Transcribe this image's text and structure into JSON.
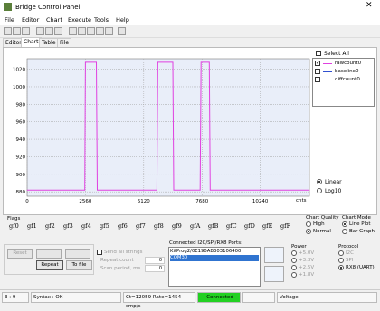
{
  "app": {
    "title": "Bridge Control Panel"
  },
  "menu": [
    "File",
    "Editor",
    "Chart",
    "Execute",
    "Tools",
    "Help"
  ],
  "tabs": [
    "Editor",
    "Chart",
    "Table",
    "File"
  ],
  "legend": {
    "select_all": "Select All",
    "items": [
      {
        "label": "rawcount0",
        "color": "#e040e0",
        "checked": true
      },
      {
        "label": "baseline0",
        "color": "#3050d0",
        "checked": false
      },
      {
        "label": "diffcount0",
        "color": "#40c0e0",
        "checked": false
      }
    ]
  },
  "scale": {
    "options": [
      "Linear",
      "Log10"
    ],
    "selected": "Linear"
  },
  "x_unit": "cnts",
  "flags": {
    "label": "Flags",
    "items": [
      "gf0",
      "gf1",
      "gf2",
      "gf3",
      "gf4",
      "gf5",
      "gf6",
      "gf7",
      "gf8",
      "gf9",
      "gfA",
      "gfB",
      "gfC",
      "gfD",
      "gfE",
      "gfF"
    ]
  },
  "chart_quality": {
    "label": "Chart Quality",
    "options": [
      "High",
      "Normal"
    ],
    "selected": "Normal"
  },
  "chart_mode": {
    "label": "Chart Mode",
    "options": [
      "Line Plot",
      "Bar Graph"
    ],
    "selected": "Line Plot"
  },
  "controls": {
    "reset": "Reset",
    "repeat": "Repeat",
    "to_file": "To file",
    "send_all": "Send all strings",
    "repeat_count": "Repeat count",
    "scan_period": "Scan period, ms",
    "repeat_count_value": "0",
    "scan_period_value": "0"
  },
  "ports": {
    "label": "Connected I2C/SPI/RX8 Ports:",
    "items": [
      "KitProg2/0E190AB303106400",
      "COM30"
    ],
    "selected": 1
  },
  "power": {
    "label": "Power",
    "options": [
      "+5.0V",
      "+3.3V",
      "+2.5V",
      "+1.8V"
    ]
  },
  "protocol": {
    "label": "Protocol",
    "options": [
      "I2C",
      "SPI",
      "RX8 (UART)"
    ],
    "selected": "RX8 (UART)"
  },
  "status": {
    "pos": "3 : 9",
    "syntax": "Syntax : OK",
    "rate": "Ct=12059 Rate=1454 smp/s",
    "connection": "Connected",
    "voltage": "Voltage: -"
  },
  "chart_data": {
    "type": "line",
    "series": [
      {
        "name": "rawcount0",
        "color": "#e040e0",
        "x": [
          0,
          2530,
          2560,
          2600,
          3040,
          3080,
          5700,
          5740,
          6400,
          6440,
          7600,
          7640,
          8000,
          8040,
          12400
        ],
        "y": [
          882,
          882,
          1028,
          1028,
          1028,
          882,
          882,
          1028,
          1028,
          882,
          882,
          1028,
          1028,
          882,
          882
        ]
      }
    ],
    "xticks": [
      0,
      2560,
      5120,
      7680,
      10240
    ],
    "yticks": [
      880,
      900,
      920,
      940,
      960,
      980,
      1000,
      1020
    ],
    "xlim": [
      0,
      12400
    ],
    "ylim": [
      875,
      1032
    ],
    "grid": true,
    "legend": "top-right"
  }
}
